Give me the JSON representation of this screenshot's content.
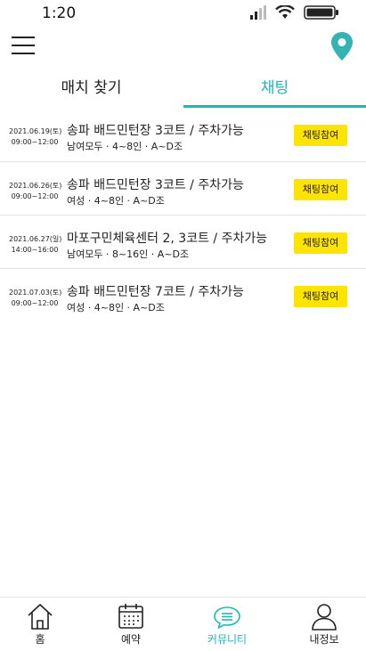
{
  "status_bar": {
    "time": "1:20"
  },
  "header": {
    "menu_icon": "hamburger-icon",
    "location_icon": "map-pin-icon",
    "accent": "#1fb6b6"
  },
  "tabs": [
    {
      "label": "매치 찾기",
      "active": false
    },
    {
      "label": "채팅",
      "active": true
    }
  ],
  "matches": [
    {
      "date": "2021.06.19(토)",
      "time": "09:00~12:00",
      "title": "송파 배드민턴장 3코트 / 주차가능",
      "meta": "남여모두  ·  4~8인  ·  A~D조",
      "button": "채팅참여"
    },
    {
      "date": "2021.06.26(토)",
      "time": "09:00~12:00",
      "title": "송파 배드민턴장 3코트 / 주차가능",
      "meta": "여성  ·  4~8인  ·  A~D조",
      "button": "채팅참여"
    },
    {
      "date": "2021.06.27(일)",
      "time": "14:00~16:00",
      "title": "마포구민체육센터 2, 3코트 / 주차가능",
      "meta": "남여모두  ·  8~16인  ·  A~D조",
      "button": "채팅참여"
    },
    {
      "date": "2021.07.03(토)",
      "time": "09:00~12:00",
      "title": "송파 배드민턴장 7코트 / 주차가능",
      "meta": "여성  ·  4~8인  ·  A~D조",
      "button": "채팅참여"
    }
  ],
  "bottom_nav": [
    {
      "label": "홈",
      "icon": "home-icon",
      "active": false
    },
    {
      "label": "예약",
      "icon": "calendar-icon",
      "active": false
    },
    {
      "label": "커뮤니티",
      "icon": "chat-bubble-icon",
      "active": true
    },
    {
      "label": "내정보",
      "icon": "user-icon",
      "active": false
    }
  ],
  "colors": {
    "accent": "#1fb6b6",
    "button_bg": "#ffe400"
  }
}
